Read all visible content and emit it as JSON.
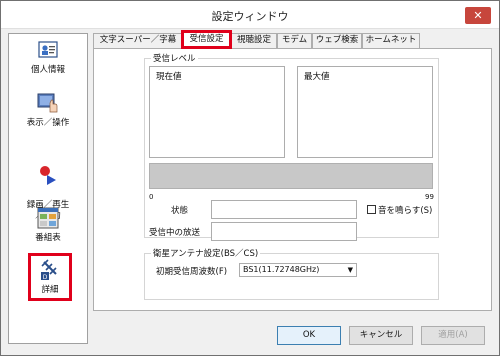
{
  "window": {
    "title": "設定ウィンドウ",
    "close_label": "✕"
  },
  "sidebar": {
    "items": [
      {
        "label": "個人情報",
        "icon": "person-card-icon"
      },
      {
        "label": "表示／操作",
        "icon": "display-hand-icon"
      },
      {
        "label": "録画／再生\n／予約",
        "icon": "record-play-icon"
      },
      {
        "label": "番組表",
        "icon": "program-guide-icon"
      },
      {
        "label": "詳細",
        "icon": "antenna-detail-icon",
        "selected": true
      }
    ]
  },
  "tabs": [
    {
      "label": "文字スーパー／字幕"
    },
    {
      "label": "受信設定",
      "active": true
    },
    {
      "label": "視聴設定"
    },
    {
      "label": "モデム"
    },
    {
      "label": "ウェブ検索"
    },
    {
      "label": "ホームネット"
    }
  ],
  "reception": {
    "group_label": "受信レベル",
    "current_label": "現在値",
    "max_label": "最大値",
    "scale_min": "0",
    "scale_max": "99",
    "status_label": "状態",
    "channel_label": "受信中の放送",
    "sound_label": "音を鳴らす(S)"
  },
  "satellite": {
    "group_label": "衛星アンテナ設定(BS／CS)",
    "freq_label": "初期受信周波数(F)",
    "freq_value": "BS1(11.72748GHz)"
  },
  "buttons": {
    "ok": "OK",
    "cancel": "キャンセル",
    "apply": "適用(A)"
  },
  "colors": {
    "highlight": "#e0001b",
    "close": "#c7463c"
  }
}
